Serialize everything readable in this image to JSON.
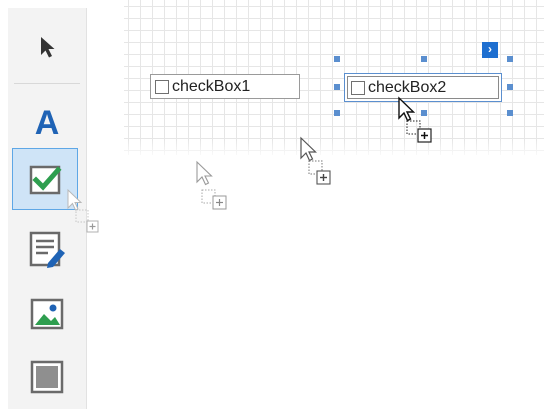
{
  "toolbox": {
    "tools": [
      {
        "name": "pointer-tool-icon"
      },
      {
        "name": "label-tool-icon",
        "glyph": "A"
      },
      {
        "name": "checkbox-tool-icon",
        "selected": true
      },
      {
        "name": "richtext-tool-icon"
      },
      {
        "name": "picturebox-tool-icon"
      },
      {
        "name": "panel-tool-icon"
      }
    ]
  },
  "surface": {
    "controls": [
      {
        "label": "checkBox1",
        "selected": false
      },
      {
        "label": "checkBox2",
        "selected": true
      }
    ],
    "smart_tag_glyph": "›"
  },
  "colors": {
    "accent": "#1e6fd0",
    "selection_fill": "#cfe4f7",
    "check_green": "#2e9e4f",
    "label_blue": "#1f63b5"
  }
}
